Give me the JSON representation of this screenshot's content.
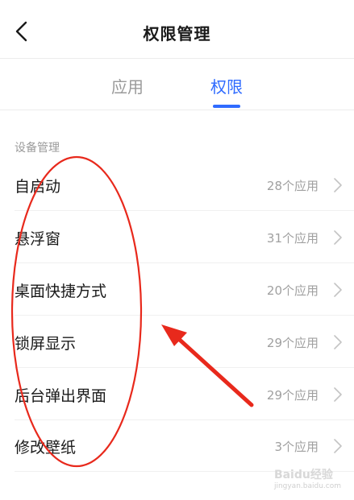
{
  "header": {
    "title": "权限管理"
  },
  "tabs": [
    {
      "label": "应用"
    },
    {
      "label": "权限"
    }
  ],
  "section": {
    "label": "设备管理"
  },
  "items": [
    {
      "label": "自启动",
      "count": "28个应用"
    },
    {
      "label": "悬浮窗",
      "count": "31个应用"
    },
    {
      "label": "桌面快捷方式",
      "count": "20个应用"
    },
    {
      "label": "锁屏显示",
      "count": "29个应用"
    },
    {
      "label": "后台弹出界面",
      "count": "29个应用"
    },
    {
      "label": "修改壁纸",
      "count": "3个应用"
    }
  ],
  "watermark": {
    "text": "Baidu经验",
    "url": "jingyan.baidu.com"
  },
  "colors": {
    "accent": "#2f6bff",
    "annotation": "#e8291c",
    "muted": "#9a9a9a"
  },
  "icons": {
    "back": "chevron-left-icon",
    "row": "chevron-right-icon"
  }
}
